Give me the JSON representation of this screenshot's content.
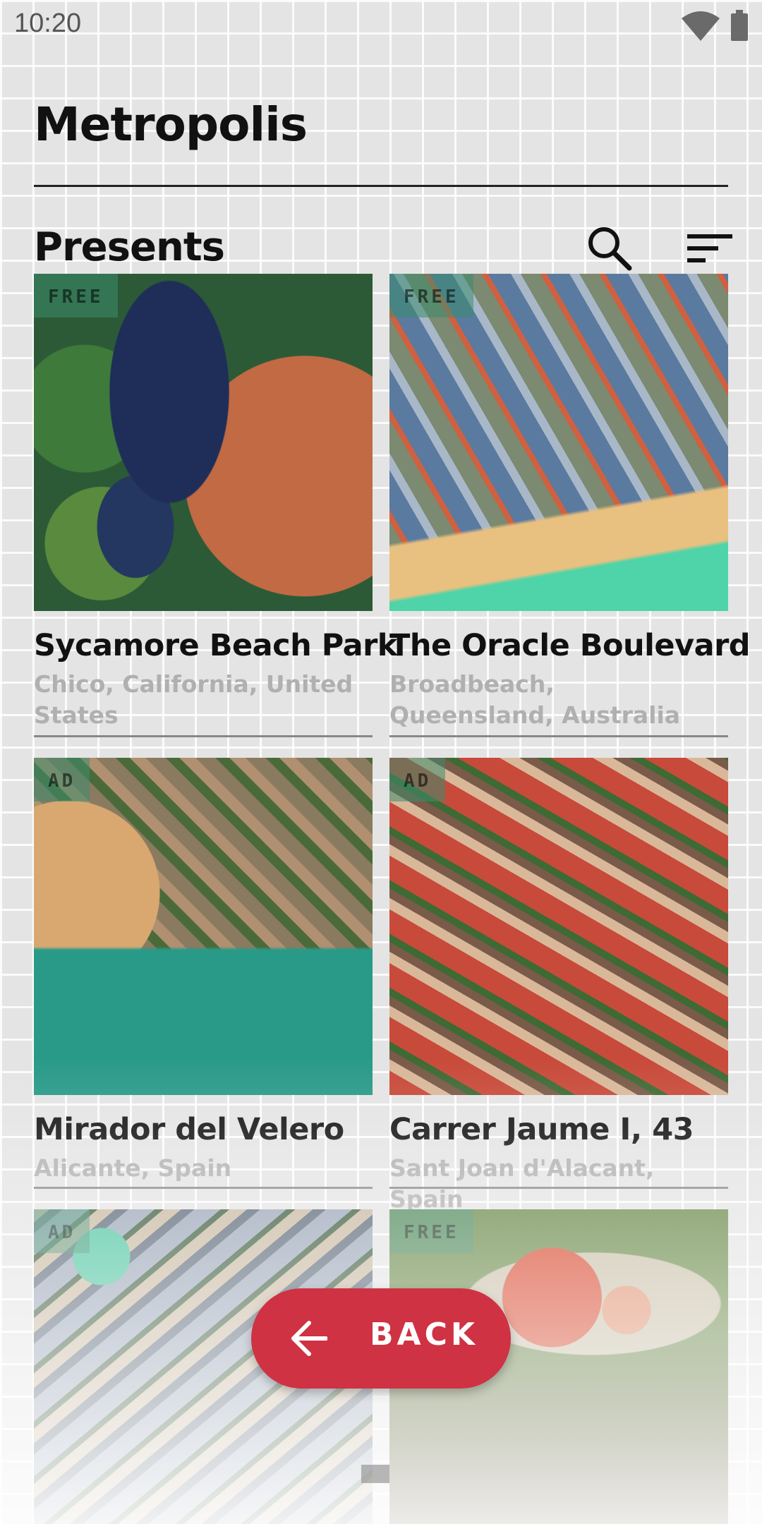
{
  "status_bar": {
    "time": "10:20"
  },
  "header": {
    "title": "Metropolis"
  },
  "section": {
    "title": "Presents"
  },
  "cards": [
    {
      "badge": "FREE",
      "name": "Sycamore Beach Park",
      "location": "Chico, California, United States"
    },
    {
      "badge": "FREE",
      "name": "The Oracle Boulevard",
      "location": "Broadbeach, Queensland, Australia"
    },
    {
      "badge": "AD",
      "name": "Mirador del Velero",
      "location": "Alicante, Spain"
    },
    {
      "badge": "AD",
      "name": "Carrer Jaume I, 43",
      "location": "Sant Joan d'Alacant, Spain"
    },
    {
      "badge": "AD"
    },
    {
      "badge": "FREE"
    }
  ],
  "back_button": {
    "label": "BACK"
  },
  "colors": {
    "accent": "#cf3243",
    "badge_bg": "#3c8c6e",
    "subtitle": "#b0b0b0"
  }
}
